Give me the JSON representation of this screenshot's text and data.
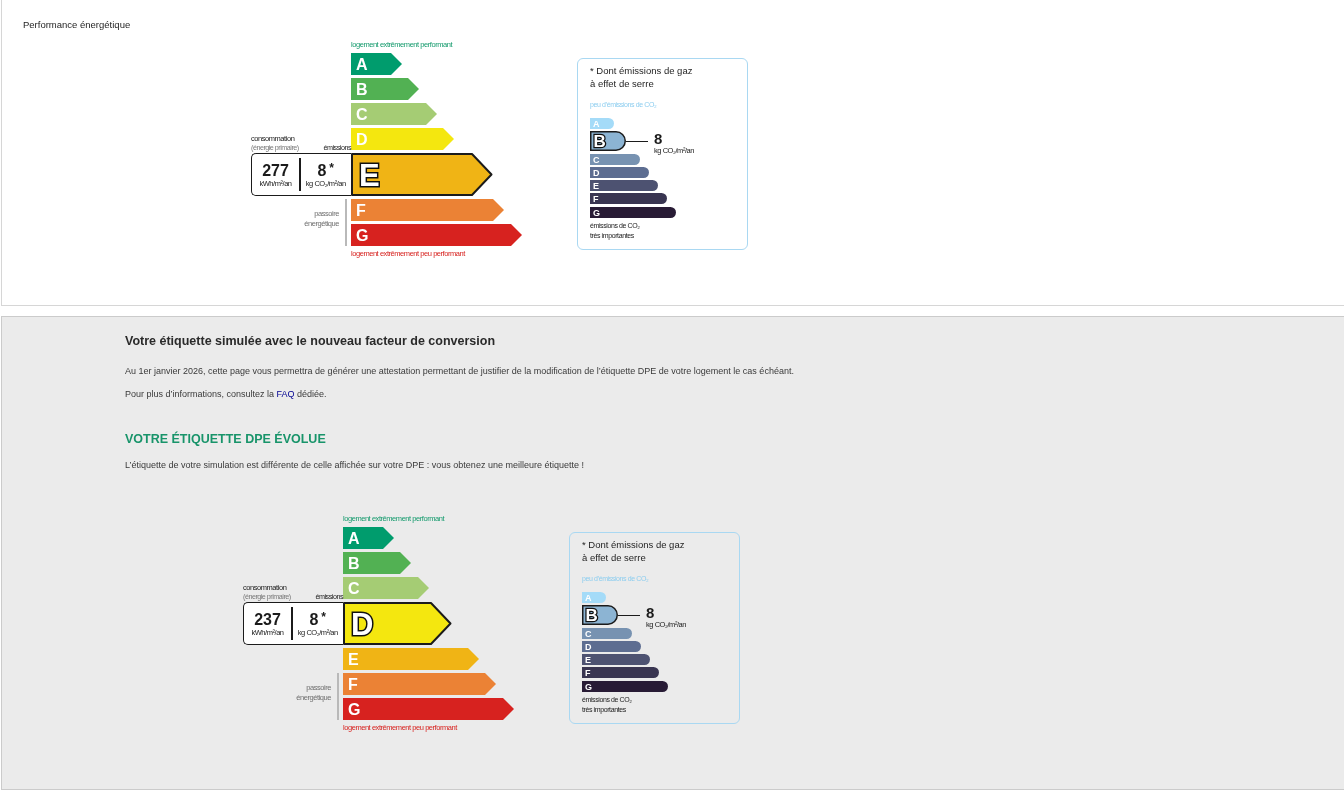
{
  "energy_section": {
    "title": "Performance énergétique",
    "dpe_label": {
      "top_caption": "logement extrêmement performant",
      "consumption_caption": "consommation",
      "consumption_subcaption": "(énergie primaire)",
      "emissions_caption": "émissions",
      "consumption_value": "277",
      "consumption_unit": "kWh/m²/an",
      "emissions_value": "8",
      "emissions_note": "*",
      "emissions_unit": "kg CO₂/m²/an",
      "passoire_caption": "passoire énergétique",
      "bottom_caption": "logement extrêmement peu performant",
      "classes": [
        {
          "letter": "A",
          "color": "#009c6d",
          "selected": false,
          "passoire": false
        },
        {
          "letter": "B",
          "color": "#52b153",
          "selected": false,
          "passoire": false
        },
        {
          "letter": "C",
          "color": "#a5cc74",
          "selected": false,
          "passoire": false
        },
        {
          "letter": "D",
          "color": "#f4e70f",
          "selected": false,
          "passoire": false
        },
        {
          "letter": "E",
          "color": "#f0b415",
          "selected": true,
          "passoire": false
        },
        {
          "letter": "F",
          "color": "#eb8235",
          "selected": false,
          "passoire": true
        },
        {
          "letter": "G",
          "color": "#d7221f",
          "selected": false,
          "passoire": true
        }
      ]
    },
    "ges_box": {
      "title": "* Dont émissions de gaz à effet de serre",
      "top_caption": "peu d’émissions de CO₂",
      "value": "8",
      "unit": "kg CO₂/m²/an",
      "bottom_caption": "émissions de CO₂ très importantes",
      "classes": [
        {
          "letter": "A",
          "color": "#a4dbf8",
          "selected": false
        },
        {
          "letter": "B",
          "color": "#8cb4d3",
          "selected": true
        },
        {
          "letter": "C",
          "color": "#7792b1",
          "selected": false
        },
        {
          "letter": "D",
          "color": "#5d6d91",
          "selected": false
        },
        {
          "letter": "E",
          "color": "#4d5271",
          "selected": false
        },
        {
          "letter": "F",
          "color": "#393551",
          "selected": false
        },
        {
          "letter": "G",
          "color": "#281b35",
          "selected": false
        }
      ]
    }
  },
  "simulation_section": {
    "heading": "Votre étiquette simulée avec le nouveau facteur de conversion",
    "intro": "Au 1er janvier 2026, cette page vous permettra de générer une attestation permettant de justifier de la modification de l’étiquette DPE de votre logement le cas échéant.",
    "info": {
      "text_before": "Pour plus d’informations, consultez la ",
      "link": "FAQ",
      "text_after": " dédiée."
    },
    "result_heading": "VOTRE ÉTIQUETTE DPE ÉVOLUE",
    "result_message": "L’étiquette de votre simulation est différente de celle affichée sur votre DPE : vous obtenez une meilleure étiquette !",
    "dpe_label": {
      "top_caption": "logement extrêmement performant",
      "consumption_caption": "consommation",
      "consumption_subcaption": "(énergie primaire)",
      "emissions_caption": "émissions",
      "consumption_value": "237",
      "consumption_unit": "kWh/m²/an",
      "emissions_value": "8",
      "emissions_note": "*",
      "emissions_unit": "kg CO₂/m²/an",
      "passoire_caption": "passoire énergétique",
      "bottom_caption": "logement extrêmement peu performant",
      "classes": [
        {
          "letter": "A",
          "color": "#009c6d",
          "selected": false,
          "passoire": false
        },
        {
          "letter": "B",
          "color": "#52b153",
          "selected": false,
          "passoire": false
        },
        {
          "letter": "C",
          "color": "#a5cc74",
          "selected": false,
          "passoire": false
        },
        {
          "letter": "D",
          "color": "#f4e70f",
          "selected": true,
          "passoire": false
        },
        {
          "letter": "E",
          "color": "#f0b415",
          "selected": false,
          "passoire": false
        },
        {
          "letter": "F",
          "color": "#eb8235",
          "selected": false,
          "passoire": true
        },
        {
          "letter": "G",
          "color": "#d7221f",
          "selected": false,
          "passoire": true
        }
      ]
    },
    "ges_box": {
      "title": "* Dont émissions de gaz à effet de serre",
      "top_caption": "peu d’émissions de CO₂",
      "value": "8",
      "unit": "kg CO₂/m²/an",
      "bottom_caption": "émissions de CO₂ très importantes",
      "classes": [
        {
          "letter": "A",
          "color": "#a4dbf8",
          "selected": false
        },
        {
          "letter": "B",
          "color": "#8cb4d3",
          "selected": true
        },
        {
          "letter": "C",
          "color": "#7792b1",
          "selected": false
        },
        {
          "letter": "D",
          "color": "#5d6d91",
          "selected": false
        },
        {
          "letter": "E",
          "color": "#4d5271",
          "selected": false
        },
        {
          "letter": "F",
          "color": "#393551",
          "selected": false
        },
        {
          "letter": "G",
          "color": "#281b35",
          "selected": false
        }
      ]
    }
  }
}
